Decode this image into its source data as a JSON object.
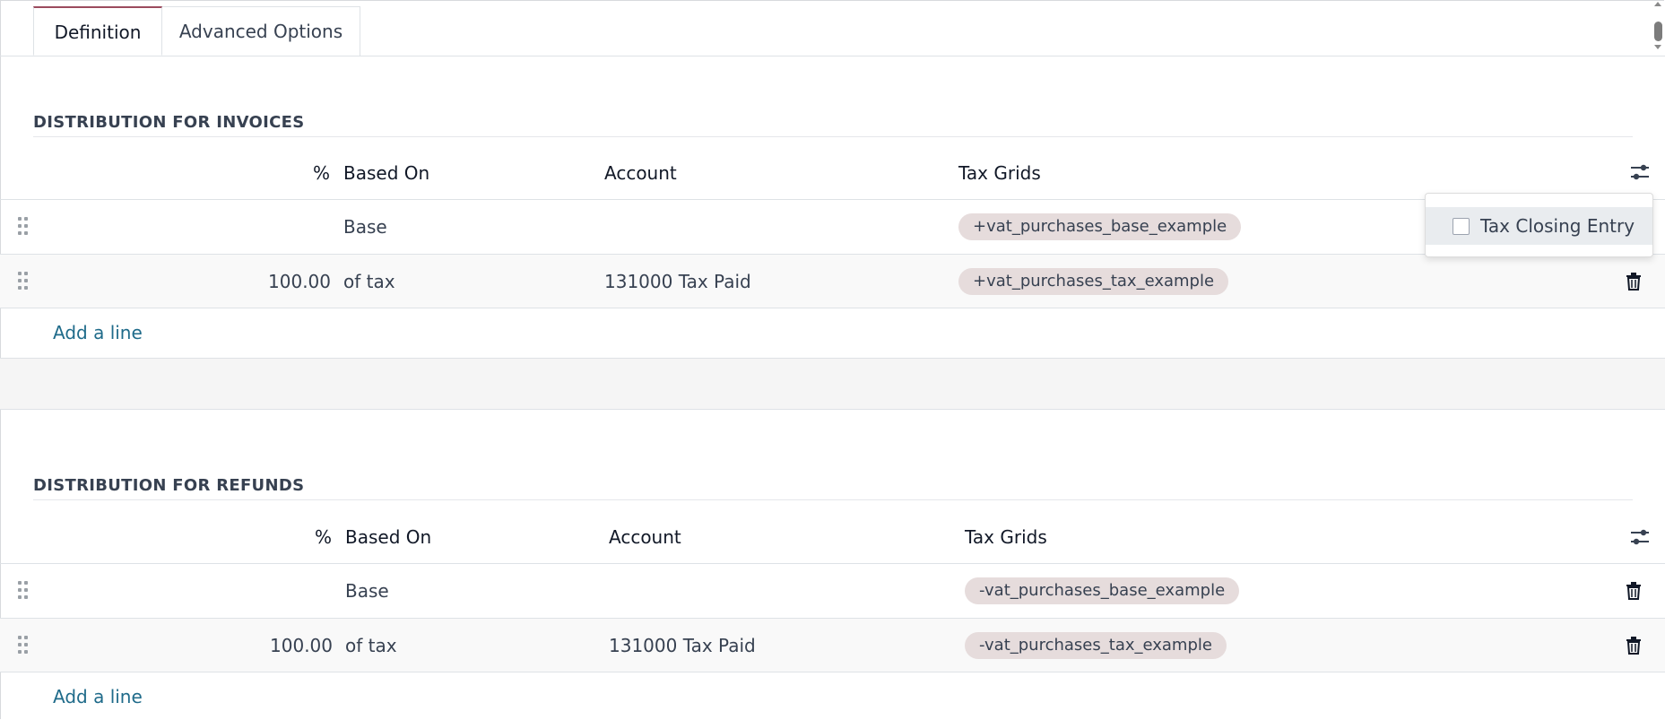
{
  "tabs": [
    {
      "label": "Definition",
      "active": true
    },
    {
      "label": "Advanced Options",
      "active": false
    }
  ],
  "invoices": {
    "title": "DISTRIBUTION FOR INVOICES",
    "columns": {
      "percent": "%",
      "based_on": "Based On",
      "account": "Account",
      "tax_grids": "Tax Grids"
    },
    "rows": [
      {
        "percent": "",
        "based_on": "Base",
        "account": "",
        "tax_grid": "+vat_purchases_base_example"
      },
      {
        "percent": "100.00",
        "based_on": "of tax",
        "account": "131000 Tax Paid",
        "tax_grid": "+vat_purchases_tax_example"
      }
    ],
    "add_line": "Add a line"
  },
  "refunds": {
    "title": "DISTRIBUTION FOR REFUNDS",
    "columns": {
      "percent": "%",
      "based_on": "Based On",
      "account": "Account",
      "tax_grids": "Tax Grids"
    },
    "rows": [
      {
        "percent": "",
        "based_on": "Base",
        "account": "",
        "tax_grid": "-vat_purchases_base_example"
      },
      {
        "percent": "100.00",
        "based_on": "of tax",
        "account": "131000 Tax Paid",
        "tax_grid": "-vat_purchases_tax_example"
      }
    ],
    "add_line": "Add a line"
  },
  "column_options": {
    "items": [
      {
        "label": "Tax Closing Entry",
        "checked": false
      }
    ]
  },
  "colors": {
    "accent_tab": "#9b4b5e",
    "link": "#1f6b8a",
    "tag_bg": "#e6dcdc"
  }
}
